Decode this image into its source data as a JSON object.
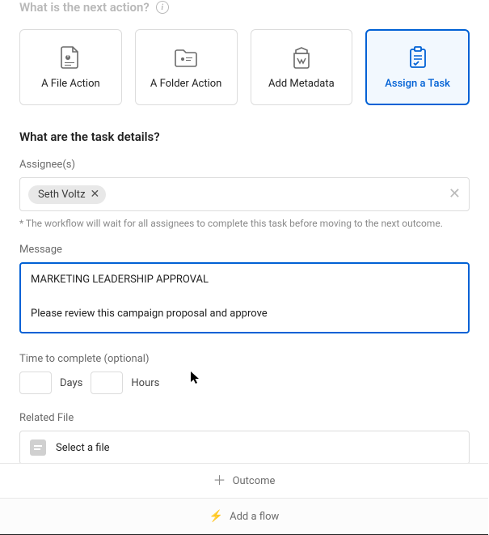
{
  "header": {
    "question": "What is the next action?"
  },
  "actions": {
    "file": "A File Action",
    "folder": "A Folder Action",
    "metadata": "Add Metadata",
    "task": "Assign a Task",
    "selected": "task"
  },
  "details": {
    "title": "What are the task details?",
    "assignee_label": "Assignee(s)",
    "assignees": [
      "Seth Voltz"
    ],
    "assignee_helper": "* The workflow will wait for all assignees to complete this task before moving to the next outcome.",
    "message_label": "Message",
    "message_value": "MARKETING LEADERSHIP APPROVAL\n\nPlease review this campaign proposal and approve",
    "time_label": "Time to complete (optional)",
    "days_value": "",
    "days_unit": "Days",
    "hours_value": "",
    "hours_unit": "Hours",
    "related_file_label": "Related File",
    "select_file_placeholder": "Select a file"
  },
  "footer": {
    "outcome": "Outcome",
    "add_flow": "Add a flow"
  },
  "colors": {
    "accent": "#0061d5"
  }
}
